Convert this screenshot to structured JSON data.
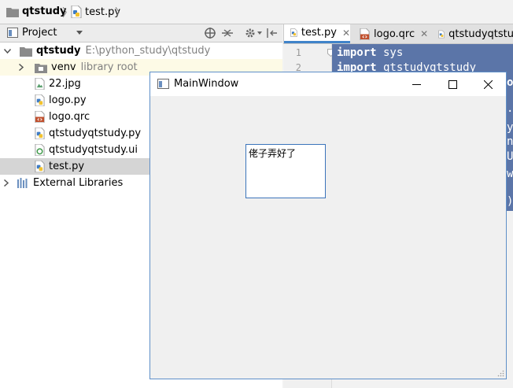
{
  "breadcrumb": {
    "items": [
      {
        "label": "qtstudy",
        "icon": "folder-icon"
      },
      {
        "label": "test.py",
        "icon": "python-file-icon"
      }
    ]
  },
  "project_panel": {
    "title": "Project",
    "tree": [
      {
        "label": "qtstudy",
        "hint": "E:\\python_study\\qtstudy",
        "icon": "folder-icon",
        "expanded": true
      },
      {
        "label": "venv",
        "hint": "library root",
        "icon": "folder-icon"
      },
      {
        "label": "22.jpg",
        "icon": "image-file-icon"
      },
      {
        "label": "logo.py",
        "icon": "python-file-icon"
      },
      {
        "label": "logo.qrc",
        "icon": "qrc-file-icon"
      },
      {
        "label": "qtstudyqtstudy.py",
        "icon": "python-file-icon"
      },
      {
        "label": "qtstudyqtstudy.ui",
        "icon": "ui-file-icon"
      },
      {
        "label": "test.py",
        "icon": "python-file-icon",
        "selected": true
      },
      {
        "label": "External Libraries",
        "icon": "libraries-icon"
      }
    ]
  },
  "editor": {
    "tabs": [
      {
        "label": "test.py",
        "active": true
      },
      {
        "label": "logo.qrc",
        "active": false
      },
      {
        "label": "qtstudyqtstu",
        "active": false
      }
    ],
    "line_numbers": [
      "1",
      "2"
    ],
    "code_lines": [
      {
        "keyword": "import",
        "rest": " sys"
      },
      {
        "keyword": "import",
        "rest": " qtstudyqtstudy"
      }
    ],
    "right_fragments": [
      "o",
      ".",
      "y",
      "n",
      "U",
      "w",
      ")"
    ],
    "selection_color": "#5b75a8"
  },
  "qt_window": {
    "title": "MainWindow",
    "label_text": "佬子弄好了"
  }
}
